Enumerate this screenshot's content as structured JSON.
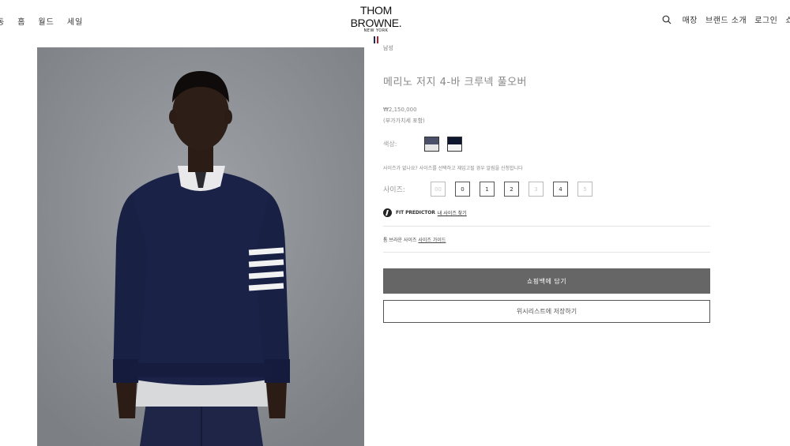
{
  "header": {
    "nav_left": [
      "동",
      "홈",
      "월드",
      "세일"
    ],
    "logo": {
      "brand": "THOM BROWNE.",
      "sub": "NEW YORK",
      "flag_colors": [
        "#1f2a55",
        "#ffffff",
        "#b21f2d"
      ]
    },
    "nav_right": [
      "매장",
      "브랜드 소개",
      "로그인",
      "쇼"
    ],
    "search_icon": "search-icon"
  },
  "product": {
    "category": "남성",
    "title": "메리노 저지 4-바 크루넥 풀오버",
    "price": "₩2,150,000",
    "vat_note": "(부가가치세 포함)",
    "color_label": "색상:",
    "colors": [
      {
        "name": "grey-navy",
        "top": "#4a5068",
        "bottom": "#e6e6e6"
      },
      {
        "name": "navy",
        "top": "#0f1630",
        "bottom": "#f4f4f4"
      }
    ],
    "size_help": "사이즈가 없나요? 사이즈를 선택하고 재입고될 경우 알림을 신청합니다",
    "size_label": "사이즈:",
    "sizes": [
      {
        "label": "00",
        "available": false
      },
      {
        "label": "0",
        "available": true
      },
      {
        "label": "1",
        "available": true
      },
      {
        "label": "2",
        "available": true
      },
      {
        "label": "3",
        "available": false
      },
      {
        "label": "4",
        "available": true
      },
      {
        "label": "5",
        "available": false
      }
    ],
    "fit_predictor": {
      "label": "FIT PREDICTOR",
      "link": "내 사이즈 찾기"
    },
    "size_guide": {
      "prefix": "톰 브라운 사이즈",
      "link": "사이즈 가이드"
    },
    "add_to_bag": "쇼핑백에 담기",
    "wishlist": "위시리스트에 저장하기"
  }
}
